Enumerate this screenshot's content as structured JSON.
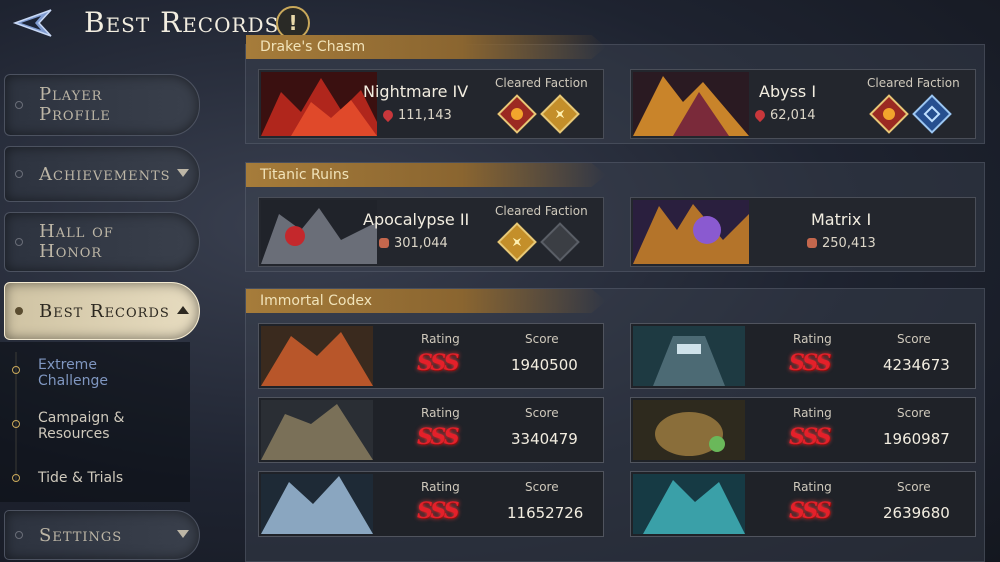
{
  "header": {
    "title": "Best Records",
    "info_glyph": "!"
  },
  "sidebar": {
    "items": [
      {
        "label": "Player Profile"
      },
      {
        "label": "Achievements"
      },
      {
        "label": "Hall of Honor"
      },
      {
        "label": "Best Records"
      },
      {
        "label": "Settings"
      }
    ],
    "subitems": [
      {
        "label": "Extreme Challenge"
      },
      {
        "label": "Campaign & Resources"
      },
      {
        "label": "Tide & Trials"
      }
    ]
  },
  "sections": {
    "drakes_chasm": {
      "title": "Drake's Chasm",
      "cards": [
        {
          "boss": "Nightmare IV",
          "power": "111,143",
          "cleared_label": "Cleared Faction",
          "factions": [
            "red",
            "gold"
          ]
        },
        {
          "boss": "Abyss I",
          "power": "62,014",
          "cleared_label": "Cleared Faction",
          "factions": [
            "red",
            "blue"
          ]
        }
      ]
    },
    "titanic_ruins": {
      "title": "Titanic Ruins",
      "cards": [
        {
          "boss": "Apocalypse II",
          "power": "301,044",
          "cleared_label": "Cleared Faction",
          "factions": [
            "gold",
            "gray"
          ]
        },
        {
          "boss": "Matrix I",
          "power": "250,413"
        }
      ]
    },
    "immortal_codex": {
      "title": "Immortal Codex",
      "rating_label": "Rating",
      "score_label": "Score",
      "entries": [
        {
          "rating": "SSS",
          "score": "1940500"
        },
        {
          "rating": "SSS",
          "score": "4234673"
        },
        {
          "rating": "SSS",
          "score": "3340479"
        },
        {
          "rating": "SSS",
          "score": "1960987"
        },
        {
          "rating": "SSS",
          "score": "11652726"
        },
        {
          "rating": "SSS",
          "score": "2639680"
        }
      ]
    }
  },
  "colors": {
    "banner": "#a67c3a",
    "rating_red": "#e4202a",
    "active_tab": "#e7dcc0"
  }
}
